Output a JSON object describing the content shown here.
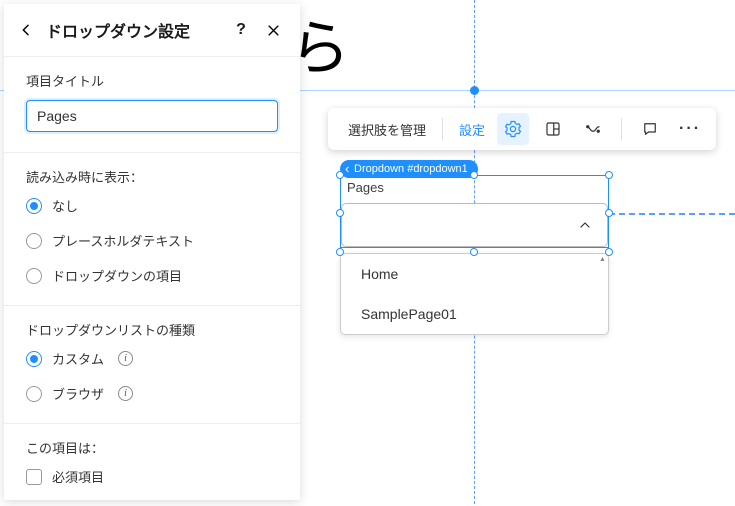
{
  "panel": {
    "title": "ドロップダウン設定",
    "field_title_label": "項目タイトル",
    "field_title_value": "Pages",
    "load_display_label": "読み込み時に表示：",
    "load_options": [
      {
        "label": "なし",
        "checked": true
      },
      {
        "label": "プレースホルダテキスト",
        "checked": false
      },
      {
        "label": "ドロップダウンの項目",
        "checked": false
      }
    ],
    "list_type_label": "ドロップダウンリストの種類",
    "list_type_options": [
      {
        "label": "カスタム",
        "checked": true,
        "info": true
      },
      {
        "label": "ブラウザ",
        "checked": false,
        "info": true
      }
    ],
    "this_field_label": "この項目は：",
    "required_label": "必須項目"
  },
  "toolbar": {
    "manage": "選択肢を管理",
    "settings": "設定"
  },
  "canvas": {
    "tag": "Dropdown #dropdown1",
    "dd_label": "Pages",
    "items": [
      "Home",
      "SamplePage01"
    ]
  }
}
